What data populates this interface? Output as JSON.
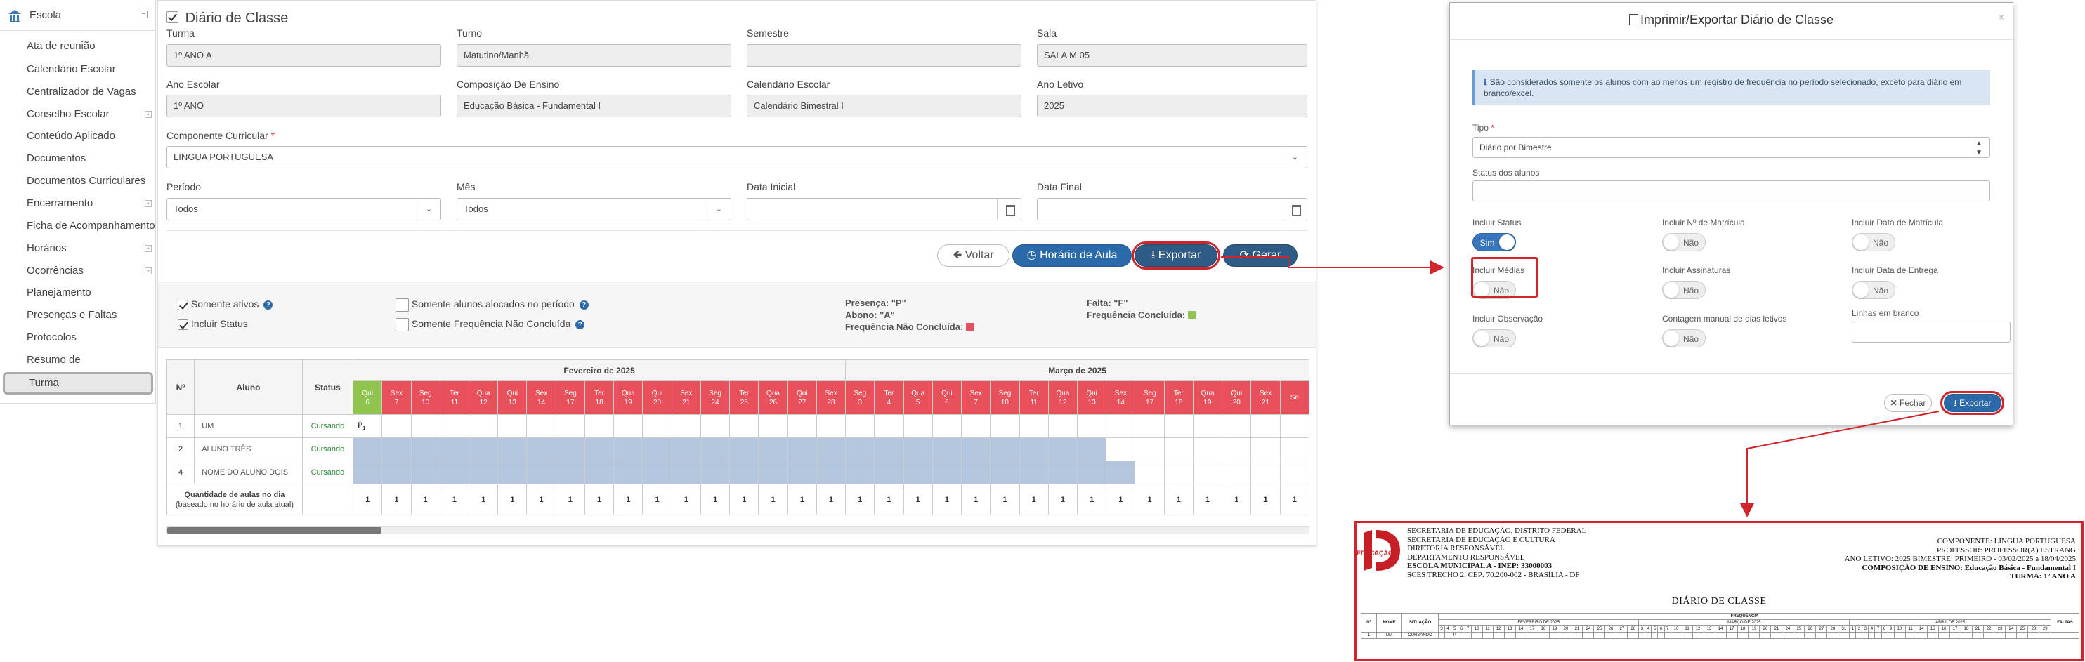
{
  "sidebar": {
    "header": "Escola",
    "items": [
      {
        "label": "Ata de reunião",
        "expandable": false
      },
      {
        "label": "Calendário Escolar",
        "expandable": false
      },
      {
        "label": "Centralizador de Vagas",
        "expandable": false
      },
      {
        "label": "Conselho Escolar",
        "expandable": true
      },
      {
        "label": "Conteúdo Aplicado",
        "expandable": false
      },
      {
        "label": "Documentos",
        "expandable": false
      },
      {
        "label": "Documentos Curriculares",
        "expandable": false
      },
      {
        "label": "Encerramento",
        "expandable": true
      },
      {
        "label": "Ficha de Acompanhamento",
        "expandable": false
      },
      {
        "label": "Horários",
        "expandable": true
      },
      {
        "label": "Ocorrências",
        "expandable": true
      },
      {
        "label": "Planejamento",
        "expandable": false
      },
      {
        "label": "Presenças e Faltas",
        "expandable": false
      },
      {
        "label": "Protocolos",
        "expandable": false
      },
      {
        "label": "Resumo de Aproveitamento",
        "expandable": false
      }
    ],
    "active": "Turma"
  },
  "main": {
    "title": "Diário de Classe",
    "fields": {
      "turma": {
        "label": "Turma",
        "value": "1º ANO A"
      },
      "turno": {
        "label": "Turno",
        "value": "Matutino/Manhã"
      },
      "semestre": {
        "label": "Semestre",
        "value": ""
      },
      "sala": {
        "label": "Sala",
        "value": "SALA M 05"
      },
      "ano_escolar": {
        "label": "Ano Escolar",
        "value": "1º ANO"
      },
      "composicao": {
        "label": "Composição De Ensino",
        "value": "Educação Básica - Fundamental I"
      },
      "calendario": {
        "label": "Calendário Escolar",
        "value": "Calendário Bimestral I"
      },
      "ano_letivo": {
        "label": "Ano Letivo",
        "value": "2025"
      },
      "componente": {
        "label": "Componente Curricular",
        "value": "LINGUA PORTUGUESA",
        "required": "*"
      },
      "periodo": {
        "label": "Período",
        "value": "Todos"
      },
      "mes": {
        "label": "Mês",
        "value": "Todos"
      },
      "data_inicial": {
        "label": "Data Inicial",
        "value": ""
      },
      "data_final": {
        "label": "Data Final",
        "value": ""
      }
    },
    "buttons": {
      "voltar": "Voltar",
      "horario": "Horário de Aula",
      "exportar": "Exportar",
      "gerar": "Gerar"
    },
    "filters": {
      "somente_ativos": {
        "label": "Somente ativos",
        "checked": true
      },
      "incluir_status": {
        "label": "Incluir Status",
        "checked": true
      },
      "somente_alocados": {
        "label": "Somente alunos alocados no período",
        "checked": false
      },
      "somente_freq": {
        "label": "Somente Frequência Não Concluída",
        "checked": false
      }
    },
    "legend": {
      "presenca": "Presença: \"P\"",
      "abono": "Abono: \"A\"",
      "freq_nao_concluida": "Frequência Não Concluída:",
      "falta": "Falta: \"F\"",
      "freq_concluida": "Frequência Concluída:",
      "color_nao_concluida": "#e8505b",
      "color_concluida": "#8fc44d"
    },
    "table": {
      "col_num": "Nº",
      "col_aluno": "Aluno",
      "col_status": "Status",
      "month_feb": "Fevereiro de 2025",
      "month_mar": "Março de 2025",
      "days_feb": [
        [
          "Qui",
          "6"
        ],
        [
          "Sex",
          "7"
        ],
        [
          "Seg",
          "10"
        ],
        [
          "Ter",
          "11"
        ],
        [
          "Qua",
          "12"
        ],
        [
          "Qui",
          "13"
        ],
        [
          "Sex",
          "14"
        ],
        [
          "Seg",
          "17"
        ],
        [
          "Ter",
          "18"
        ],
        [
          "Qua",
          "19"
        ],
        [
          "Qui",
          "20"
        ],
        [
          "Sex",
          "21"
        ],
        [
          "Seg",
          "24"
        ],
        [
          "Ter",
          "25"
        ],
        [
          "Qua",
          "26"
        ],
        [
          "Qui",
          "27"
        ],
        [
          "Sex",
          "28"
        ]
      ],
      "days_mar": [
        [
          "Seg",
          "3"
        ],
        [
          "Ter",
          "4"
        ],
        [
          "Qua",
          "5"
        ],
        [
          "Qui",
          "6"
        ],
        [
          "Sex",
          "7"
        ],
        [
          "Seg",
          "10"
        ],
        [
          "Ter",
          "11"
        ],
        [
          "Qua",
          "12"
        ],
        [
          "Qui",
          "13"
        ],
        [
          "Sex",
          "14"
        ],
        [
          "Seg",
          "17"
        ],
        [
          "Ter",
          "18"
        ],
        [
          "Qua",
          "19"
        ],
        [
          "Qui",
          "20"
        ],
        [
          "Sex",
          "21"
        ],
        [
          "Se",
          ""
        ]
      ],
      "rows": [
        {
          "num": "1",
          "aluno": "UM",
          "status": "Cursando",
          "first": "P",
          "blue_until": 0
        },
        {
          "num": "2",
          "aluno": "ALUNO TRÊS",
          "status": "Cursando",
          "first": "",
          "blue_until": 26
        },
        {
          "num": "4",
          "aluno": "NOME DO ALUNO DOIS",
          "status": "Cursando",
          "first": "",
          "blue_until": 27
        }
      ],
      "qtd_label": "Quantidade de aulas no dia",
      "qtd_sub": "(baseado no horário de aula atual)",
      "qtd_value": "1"
    }
  },
  "modal": {
    "title": "Imprimir/Exportar Diário de Classe",
    "info": "São considerados somente os alunos com ao menos um registro de frequência no período selecionado, exceto para diário em branco/excel.",
    "tipo_label": "Tipo",
    "tipo_required": "*",
    "tipo_value": "Diário por Bimestre",
    "status_label": "Status dos alunos",
    "status_value": "",
    "toggles": [
      {
        "label": "Incluir Status",
        "value": "Sim",
        "on": true
      },
      {
        "label": "Incluir Nº de Matrícula",
        "value": "Não",
        "on": false
      },
      {
        "label": "Incluir Data de Matrícula",
        "value": "Não",
        "on": false
      },
      {
        "label": "Incluir Médias",
        "value": "Não",
        "on": false
      },
      {
        "label": "Incluir Assinaturas",
        "value": "Não",
        "on": false
      },
      {
        "label": "Incluir Data de Entrega",
        "value": "Não",
        "on": false
      },
      {
        "label": "Incluir Observação",
        "value": "Não",
        "on": false
      },
      {
        "label": "Contagem manual de dias letivos",
        "value": "Não",
        "on": false
      }
    ],
    "linhas_label": "Linhas em branco",
    "linhas_value": "",
    "fechar": "Fechar",
    "exportar": "Exportar"
  },
  "report": {
    "left_lines": [
      "SECRETARIA DE EDUCAÇÃO, DISTRITO FEDERAL",
      "SECRETARIA DE EDUCAÇÃO E CULTURA",
      "DIRETORIA RESPONSÁVEL",
      "DEPARTAMENTO RESPONSÁVEL",
      "ESCOLA MUNICIPAL A - INEP: 33000003",
      "SCES TRECHO 2, CEP: 70.200-002 - BRASÍLIA - DF"
    ],
    "right_lines": [
      "COMPONENTE: LINGUA PORTUGUESA",
      "PROFESSOR: PROFESSOR(A) ESTRANG",
      "ANO LETIVO: 2025    BIMESTRE: PRIMEIRO - 03/02/2025 a 18/04/2025",
      "COMPOSIÇÃO DE ENSINO: Educação Básica - Fundamental I",
      "TURMA: 1º ANO A"
    ],
    "logo_text": "EDUCAÇÃO",
    "title": "DIÁRIO DE CLASSE",
    "col_num": "Nº",
    "col_nome": "NOME",
    "col_situacao": "SITUAÇÃO",
    "frequencia": "FREQUÊNCIA",
    "faltas": "FALTAS",
    "month1": "FEVEREIRO DE 2025",
    "month2": "MARÇO DE 2025",
    "month3": "ABRIL DE 2025",
    "row": {
      "num": "1",
      "nome": "UM",
      "situacao": "CURSANDO",
      "first": "P"
    }
  },
  "colors": {
    "accent_blue": "#2b6aa8",
    "highlight_red": "#d0252b",
    "dark_button": "#2e5c86"
  }
}
